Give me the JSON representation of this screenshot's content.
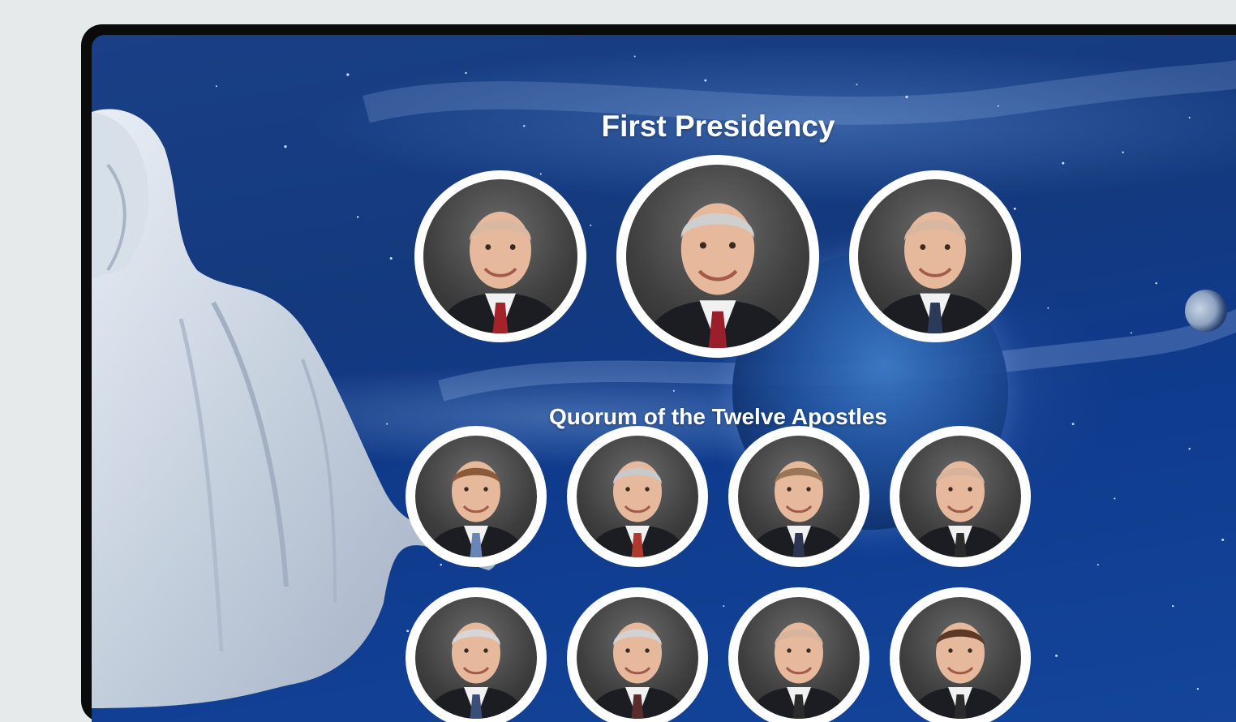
{
  "sections": {
    "first_presidency": {
      "title": "First Presidency",
      "members": [
        {
          "name": "left-counselor",
          "hair": "#d9b8a2",
          "tie": "#a3232b"
        },
        {
          "name": "president",
          "hair": "#cfcfcf",
          "tie": "#9b1f2a"
        },
        {
          "name": "right-counselor",
          "hair": "#d8b6a0",
          "tie": "#2c3a5a"
        }
      ]
    },
    "quorum": {
      "title": "Quorum of the Twelve Apostles",
      "members": [
        {
          "name": "apostle-1",
          "hair": "#8a5a3a",
          "tie": "#6a86b8"
        },
        {
          "name": "apostle-2",
          "hair": "#c9c9c9",
          "tie": "#b0392f"
        },
        {
          "name": "apostle-3",
          "hair": "#9a7658",
          "tie": "#2d3552"
        },
        {
          "name": "apostle-4",
          "hair": "#d7b39b",
          "tie": "#2b2b2b"
        },
        {
          "name": "apostle-5",
          "hair": "#d6d6d6",
          "tie": "#3a4e7a"
        },
        {
          "name": "apostle-6",
          "hair": "#d2d2d2",
          "tie": "#5a2d2d"
        },
        {
          "name": "apostle-7",
          "hair": "#d7b49e",
          "tie": "#2b2b2b"
        },
        {
          "name": "apostle-8",
          "hair": "#5a3a26",
          "tie": "#2b2b2b"
        }
      ]
    }
  },
  "colors": {
    "ring": "#ffffff",
    "heading_text": "#ffffff",
    "background_space": "#14397d"
  }
}
